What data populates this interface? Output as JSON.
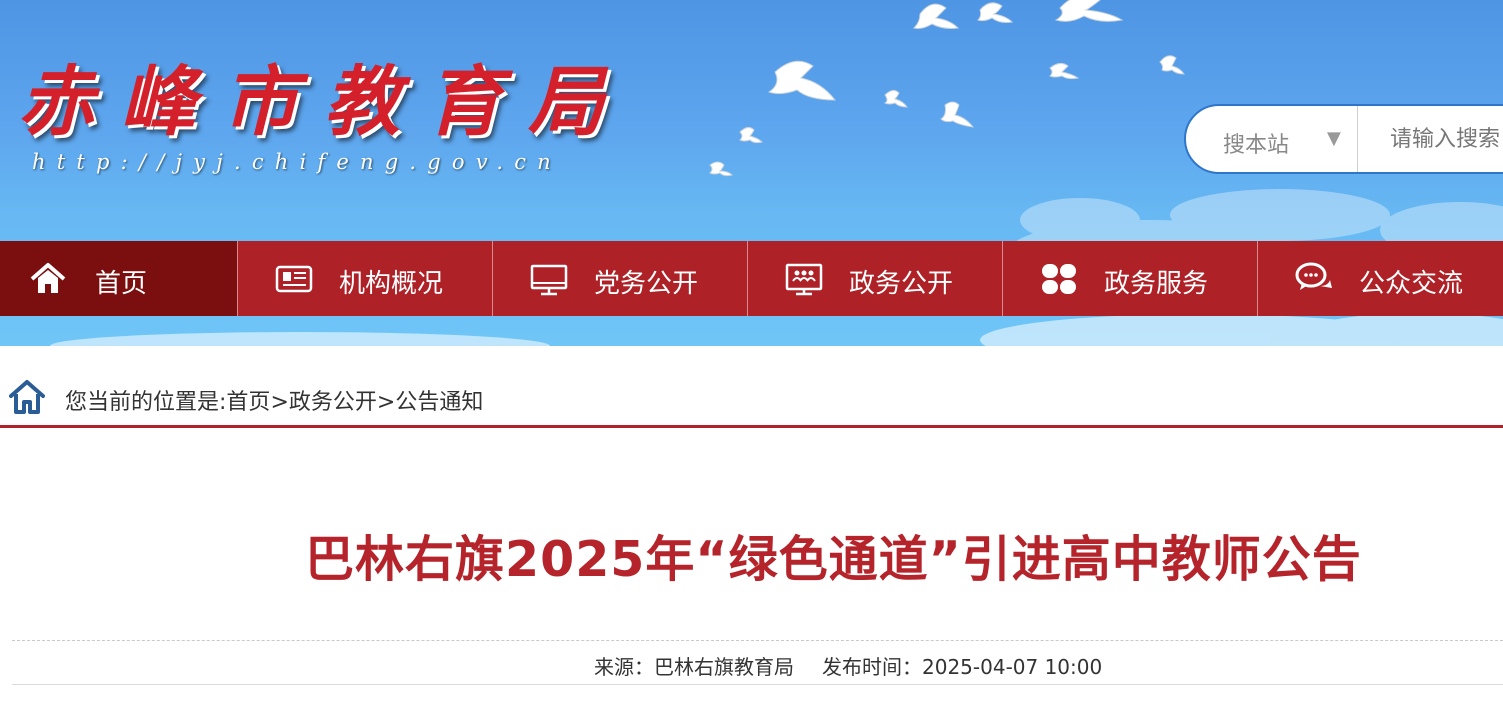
{
  "header": {
    "site_title": "赤峰市教育局",
    "site_url": "http://jyj.chifeng.gov.cn"
  },
  "search": {
    "scope_label": "搜本站",
    "placeholder": "请输入搜索"
  },
  "nav": {
    "items": [
      {
        "label": "首页",
        "icon": "home-icon"
      },
      {
        "label": "机构概况",
        "icon": "newspaper-icon"
      },
      {
        "label": "党务公开",
        "icon": "monitor-icon"
      },
      {
        "label": "政务公开",
        "icon": "screen-people-icon"
      },
      {
        "label": "政务服务",
        "icon": "grid-icon"
      },
      {
        "label": "公众交流",
        "icon": "chat-bubbles-icon"
      }
    ]
  },
  "breadcrumb": {
    "prefix": "您当前的位置是:",
    "items": [
      "首页",
      "政务公开",
      "公告通知"
    ],
    "separator": ">"
  },
  "article": {
    "title": "巴林右旗2025年“绿色通道”引进高中教师公告",
    "source": "来源：巴林右旗教育局",
    "published": "发布时间：2025-04-07 10:00"
  },
  "colors": {
    "nav_bg": "#ad2127",
    "nav_active_bg": "#7b0e0f",
    "title_red": "#b5242a",
    "search_border": "#2d76c9"
  }
}
